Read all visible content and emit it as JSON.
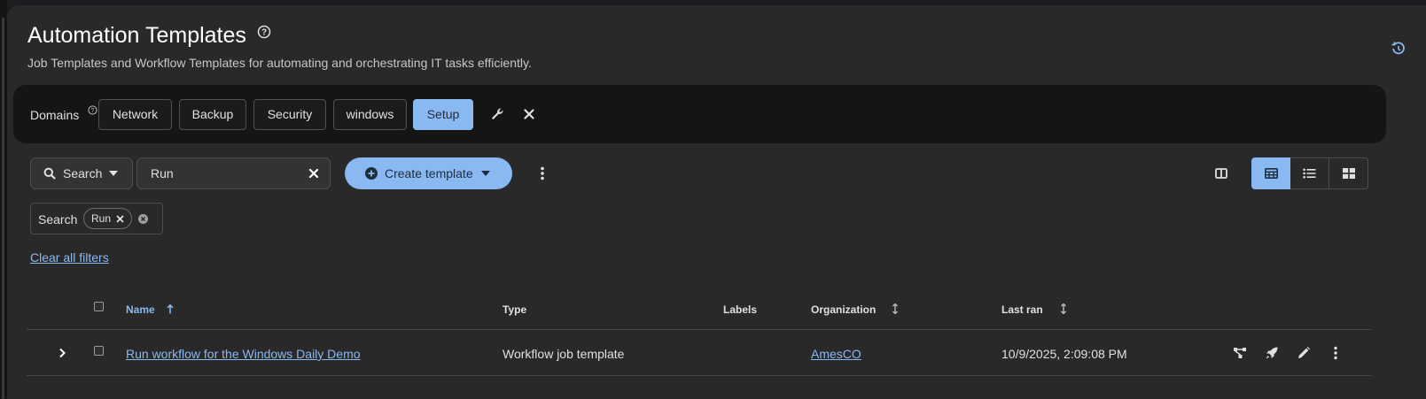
{
  "header": {
    "title": "Automation Templates",
    "subtitle": "Job Templates and Workflow Templates for automating and orchestrating IT tasks efficiently."
  },
  "domains": {
    "label": "Domains",
    "items": [
      {
        "label": "Network",
        "active": false
      },
      {
        "label": "Backup",
        "active": false
      },
      {
        "label": "Security",
        "active": false
      },
      {
        "label": "windows",
        "active": false
      },
      {
        "label": "Setup",
        "active": true
      }
    ]
  },
  "toolbar": {
    "search_select_label": "Search",
    "search_value": "Run",
    "create_label": "Create template"
  },
  "filters": {
    "group_label": "Search",
    "chips": [
      "Run"
    ],
    "clear_all_label": "Clear all filters"
  },
  "table": {
    "columns": [
      "Name",
      "Type",
      "Labels",
      "Organization",
      "Last ran"
    ],
    "rows": [
      {
        "name": "Run workflow for the Windows Daily Demo",
        "type": "Workflow job template",
        "labels": "",
        "organization": "AmesCO",
        "last_ran": "10/9/2025, 2:09:08 PM"
      }
    ]
  },
  "colors": {
    "accent": "#8ab8f0",
    "background": "#292929",
    "domains_bar": "#151515"
  },
  "icons": {
    "help": "question-circle-icon",
    "history": "history-icon",
    "manage_domains": "wrench-icon",
    "clear_domains": "close-icon",
    "search": "search-icon",
    "create": "plus-circle-icon",
    "row_actions": [
      "workflow-visualizer-icon",
      "rocket-launch-icon",
      "pencil-edit-icon",
      "kebab-icon"
    ]
  }
}
